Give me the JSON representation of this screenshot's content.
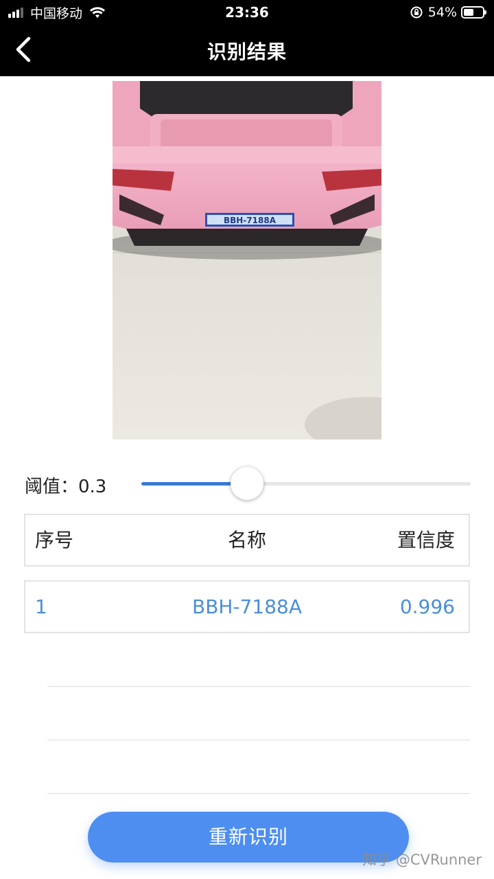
{
  "status_bar": {
    "carrier": "中国移动",
    "time": "23:36",
    "battery": "54%",
    "battery_level": 0.54
  },
  "navbar": {
    "title": "识别结果",
    "back_icon": "chevron-left-icon"
  },
  "threshold": {
    "label": "阈值：0.3",
    "value": 0.3
  },
  "table": {
    "headers": [
      "序号",
      "名称",
      "置信度"
    ],
    "rows": [
      [
        "1",
        "BBH-7188A",
        "0.996"
      ]
    ]
  },
  "photo": {
    "plate_text": "BBH-7188A"
  },
  "actions": {
    "rerecognize_label": "重新识别"
  },
  "watermark": "知乎 @CVRunner",
  "colors": {
    "accent": "#4d8ef0",
    "result_text": "#4a8ed8",
    "bar": "#000000"
  }
}
